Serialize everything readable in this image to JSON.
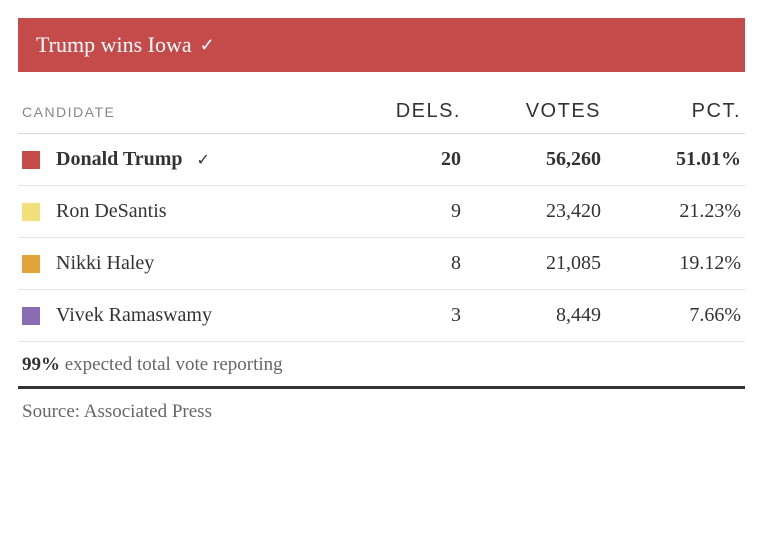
{
  "banner": {
    "text": "Trump wins Iowa",
    "check": "✓"
  },
  "headers": {
    "candidate": "CANDIDATE",
    "dels": "DELS.",
    "votes": "VOTES",
    "pct": "PCT."
  },
  "rows": [
    {
      "name": "Donald Trump",
      "winner": true,
      "check": "✓",
      "color": "#c54b4b",
      "dels": "20",
      "votes": "56,260",
      "pct": "51.01%"
    },
    {
      "name": "Ron DeSantis",
      "winner": false,
      "check": "",
      "color": "#f2e07b",
      "dels": "9",
      "votes": "23,420",
      "pct": "21.23%"
    },
    {
      "name": "Nikki Haley",
      "winner": false,
      "check": "",
      "color": "#e0a43a",
      "dels": "8",
      "votes": "21,085",
      "pct": "19.12%"
    },
    {
      "name": "Vivek Ramaswamy",
      "winner": false,
      "check": "",
      "color": "#8a6cb5",
      "dels": "3",
      "votes": "8,449",
      "pct": "7.66%"
    }
  ],
  "footer": {
    "pct": "99%",
    "text": " expected total vote reporting"
  },
  "source": "Source: Associated Press",
  "chart_data": {
    "type": "table",
    "title": "Trump wins Iowa",
    "columns": [
      "Candidate",
      "Delegates",
      "Votes",
      "Percent"
    ],
    "series": [
      {
        "name": "Donald Trump",
        "values": [
          20,
          56260,
          51.01
        ],
        "winner": true,
        "color": "#c54b4b"
      },
      {
        "name": "Ron DeSantis",
        "values": [
          9,
          23420,
          21.23
        ],
        "winner": false,
        "color": "#f2e07b"
      },
      {
        "name": "Nikki Haley",
        "values": [
          8,
          21085,
          19.12
        ],
        "winner": false,
        "color": "#e0a43a"
      },
      {
        "name": "Vivek Ramaswamy",
        "values": [
          3,
          8449,
          7.66
        ],
        "winner": false,
        "color": "#8a6cb5"
      }
    ],
    "reporting_pct": 99,
    "source": "Associated Press"
  }
}
